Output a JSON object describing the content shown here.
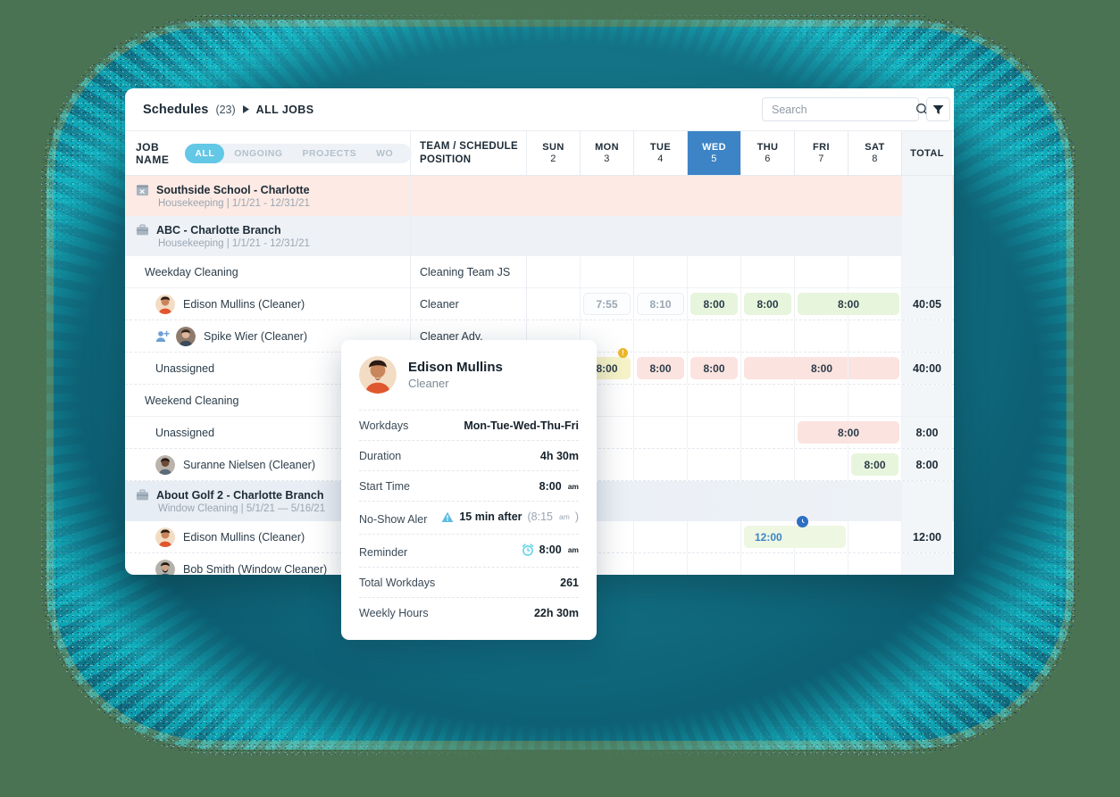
{
  "header": {
    "title": "Schedules",
    "count": "(23)",
    "arrow_icon": "caret-right-icon",
    "leaf": "ALL JOBS",
    "search_placeholder": "Search",
    "search_value": "",
    "search_icon": "search-icon",
    "filter_icon": "filter-icon"
  },
  "columns": {
    "job_name": "JOB NAME",
    "team": "TEAM / SCHEDULE POSITION",
    "team_line1": "TEAM / SCHEDULE",
    "team_line2": "POSITION",
    "total": "TOTAL",
    "filters": [
      {
        "label": "ALL",
        "active": true
      },
      {
        "label": "ONGOING",
        "active": false
      },
      {
        "label": "PROJECTS",
        "active": false
      },
      {
        "label": "WO",
        "active": false
      }
    ],
    "days": [
      {
        "name": "SUN",
        "num": "2",
        "selected": false
      },
      {
        "name": "MON",
        "num": "3",
        "selected": false
      },
      {
        "name": "TUE",
        "num": "4",
        "selected": false
      },
      {
        "name": "WED",
        "num": "5",
        "selected": true
      },
      {
        "name": "THU",
        "num": "6",
        "selected": false
      },
      {
        "name": "FRI",
        "num": "7",
        "selected": false
      },
      {
        "name": "SAT",
        "num": "8",
        "selected": false
      }
    ]
  },
  "rows": [
    {
      "kind": "job",
      "icon": "calendar-x-icon",
      "name": "Southside School - Charlotte",
      "sub": "Housekeeping | 1/1/21 - 12/31/21",
      "tone": "pink"
    },
    {
      "kind": "job",
      "icon": "briefcase-icon",
      "name": "ABC - Charlotte Branch",
      "sub": "Housekeeping | 1/1/21 - 12/31/21",
      "tone": "blue"
    },
    {
      "kind": "section",
      "name": "Weekday Cleaning",
      "team": "Cleaning Team JS"
    },
    {
      "kind": "person",
      "name": "Edison Mullins (Cleaner)",
      "team": "Cleaner",
      "total": "40:05",
      "cells": [
        {
          "day": "SUN",
          "value": ""
        },
        {
          "day": "MON",
          "value": "7:55",
          "style": "ghost"
        },
        {
          "day": "TUE",
          "value": "8:10",
          "style": "ghost"
        },
        {
          "day": "WED",
          "value": "8:00",
          "style": "green"
        },
        {
          "day": "THU",
          "value": "8:00",
          "style": "green"
        },
        {
          "day": "FRI",
          "value": "8:00",
          "style": "green",
          "span": 2
        }
      ]
    },
    {
      "kind": "person",
      "name": "Spike Wier (Cleaner)",
      "team": "Cleaner Adv.",
      "add_icon": "add-person-icon",
      "total": "",
      "cells": []
    },
    {
      "kind": "unassigned",
      "name": "Unassigned",
      "team": "",
      "total": "40:00",
      "cells": [
        {
          "day": "SUN",
          "value": "8:00",
          "style": "yellow",
          "badge": "!"
        },
        {
          "day": "MON",
          "value": "8:00",
          "style": "yellow",
          "badge": "!"
        },
        {
          "day": "TUE",
          "value": "8:00",
          "style": "pink"
        },
        {
          "day": "WED",
          "value": "8:00",
          "style": "pink"
        },
        {
          "day": "THU",
          "value": "8:00",
          "style": "pink",
          "span": 2
        }
      ]
    },
    {
      "kind": "section",
      "name": "Weekend Cleaning",
      "team": ""
    },
    {
      "kind": "unassigned",
      "name": "Unassigned",
      "team": "",
      "total": "8:00",
      "cells": [
        {
          "day": "FRI",
          "value": "8:00",
          "style": "pink",
          "span": 2
        }
      ]
    },
    {
      "kind": "person",
      "name": "Suranne Nielsen (Cleaner)",
      "team": "",
      "total": "8:00",
      "cells": [
        {
          "day": "SAT",
          "value": "8:00",
          "style": "green"
        }
      ]
    },
    {
      "kind": "job",
      "icon": "briefcase-icon",
      "name": "About Golf 2 - Charlotte Branch",
      "sub": "Window Cleaning | 5/1/21 — 5/16/21",
      "tone": "blue2"
    },
    {
      "kind": "person",
      "name": "Edison Mullins (Cleaner)",
      "team": "",
      "total": "12:00",
      "cells": [
        {
          "day": "THU",
          "value": "12:00",
          "style": "greenlite",
          "span": 2,
          "clock": "clock-icon"
        }
      ]
    },
    {
      "kind": "person",
      "name": "Bob Smith (Window Cleaner)",
      "team": "",
      "total": "",
      "cells": []
    }
  ],
  "popup": {
    "name": "Edison Mullins",
    "role": "Cleaner",
    "avatar": "user-avatar",
    "fields": [
      {
        "key": "Workdays",
        "value": "Mon-Tue-Wed-Thu-Fri"
      },
      {
        "key": "Duration",
        "value": "4h 30m"
      },
      {
        "key": "Start Time",
        "value": "8:00",
        "sup": "am"
      },
      {
        "key": "No-Show Aler",
        "value": "15 min after",
        "note": "(8:15",
        "note_sup": "am",
        "note_end": ")",
        "icon": "warning-icon"
      },
      {
        "key": "Reminder",
        "value": "8:00",
        "sup": "am",
        "icon": "alarm-clock-icon"
      },
      {
        "key": "Total Workdays",
        "value": "261"
      },
      {
        "key": "Weekly Hours",
        "value": "22h 30m"
      }
    ]
  },
  "theme": {
    "accent": "#3d84c6",
    "chip_active": "#63c7e6",
    "green_cell": "#e6f5dc",
    "pink_cell": "#fbe3e0",
    "yellow_cell": "#f7f3c8",
    "badge": "#edb62b",
    "page_bg": "#4a7354",
    "blob": "#116376"
  }
}
